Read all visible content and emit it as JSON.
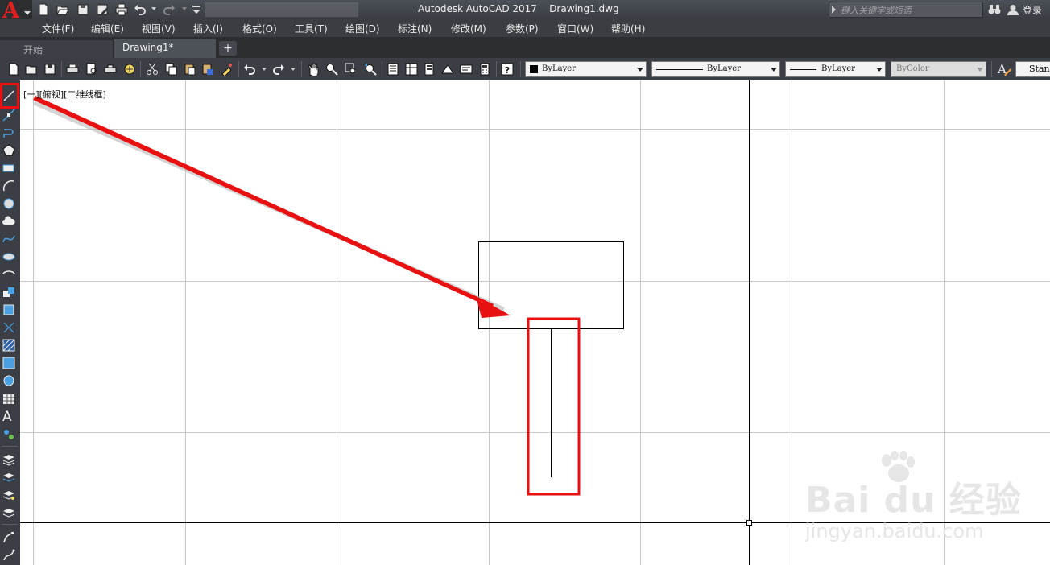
{
  "titlebar": {
    "app_title": "Autodesk AutoCAD 2017    Drawing1.dwg",
    "search_placeholder": "键入关键字或短语",
    "login_label": "登录"
  },
  "menu": {
    "items": [
      "文件(F)",
      "编辑(E)",
      "视图(V)",
      "插入(I)",
      "格式(O)",
      "工具(T)",
      "绘图(D)",
      "标注(N)",
      "修改(M)",
      "参数(P)",
      "窗口(W)",
      "帮助(H)"
    ]
  },
  "tabs": {
    "start_label": "开始",
    "drawing_label": "Drawing1*",
    "add_label": "+"
  },
  "toolbar": {
    "layer_color": "ByLayer",
    "linetype": "ByLayer",
    "lineweight": "ByLayer",
    "plot_style": "ByColor",
    "text_style": "Stand"
  },
  "canvas": {
    "viewport_label": "[一][俯视][二维线框]"
  },
  "watermark": {
    "main": "Bai du 经验",
    "sub": "jingyan.baidu.com"
  },
  "colors": {
    "annotation_red": "#e81010",
    "grid": "#c8c8c8",
    "drawing": "#000000"
  },
  "icons": {
    "quick_access": [
      "new-icon",
      "open-icon",
      "save-icon",
      "saveas-icon",
      "print-icon",
      "undo-icon",
      "redo-icon",
      "customize-icon"
    ],
    "standard_toolbar": [
      "qnew-icon",
      "open-icon",
      "save-icon",
      "plot-icon",
      "plot-preview-icon",
      "publish-icon",
      "3dprint-icon",
      "cut-icon",
      "copy-icon",
      "paste-icon",
      "paste-block-icon",
      "match-properties-icon",
      "undo-icon",
      "redo-icon",
      "pan-icon",
      "zoom-realtime-icon",
      "zoom-window-icon",
      "zoom-previous-icon",
      "properties-icon",
      "design-center-icon",
      "tool-palettes-icon",
      "sheet-set-icon",
      "markup-icon",
      "calculator-icon",
      "help-icon"
    ],
    "draw_toolbar": [
      "line-icon",
      "construction-line-icon",
      "polyline-icon",
      "polygon-icon",
      "rectangle-icon",
      "arc-icon",
      "circle-icon",
      "revision-cloud-icon",
      "spline-icon",
      "ellipse-icon",
      "ellipse-arc-icon",
      "insert-block-icon",
      "make-block-icon",
      "point-icon",
      "hatch-icon",
      "gradient-icon",
      "region-icon",
      "table-icon",
      "multiline-text-icon",
      "add-selected-icon",
      "layer-properties-icon",
      "layer-previous-icon",
      "layer-walk-icon",
      "layer-isolate-icon",
      "edit-polyline-icon",
      "edit-spline-icon"
    ]
  }
}
